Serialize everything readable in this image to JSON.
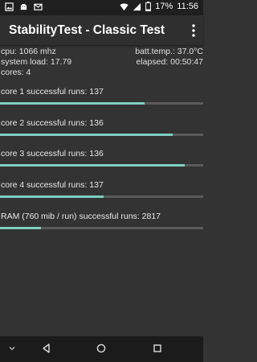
{
  "status_bar": {
    "battery_percent": "17%",
    "time": "11:56",
    "left_icons": [
      "gallery-icon",
      "android-icon",
      "gmail-icon"
    ],
    "right_icons": [
      "wifi-icon",
      "signal-icon",
      "battery-icon"
    ]
  },
  "app_bar": {
    "title": "StabilityTest - Classic Test",
    "menu_icon": "overflow-menu-icon"
  },
  "stats": {
    "cpu": "cpu: 1066 mhz",
    "batt_temp": "batt.temp.: 37.0°C",
    "system_load": "system load: 17.79",
    "elapsed": "elapsed: 00:50:47",
    "cores": "cores: 4"
  },
  "runs": [
    {
      "label": "core 1 successful runs: 137",
      "progress": 0.71
    },
    {
      "label": "core 2 successful runs: 136",
      "progress": 0.85
    },
    {
      "label": "core 3 successful runs: 136",
      "progress": 0.91
    },
    {
      "label": "core 4 successful runs: 137",
      "progress": 0.51
    },
    {
      "label": "RAM (760 mib / run) successful runs: 2817",
      "progress": 0.2
    }
  ],
  "colors": {
    "progress_fill": "#7ecfc0",
    "progress_track": "#5a5a5a",
    "background": "#333333"
  },
  "nav_bar": {
    "icons": [
      "hide-keyboard-icon",
      "back-icon",
      "home-icon",
      "recents-icon"
    ]
  }
}
